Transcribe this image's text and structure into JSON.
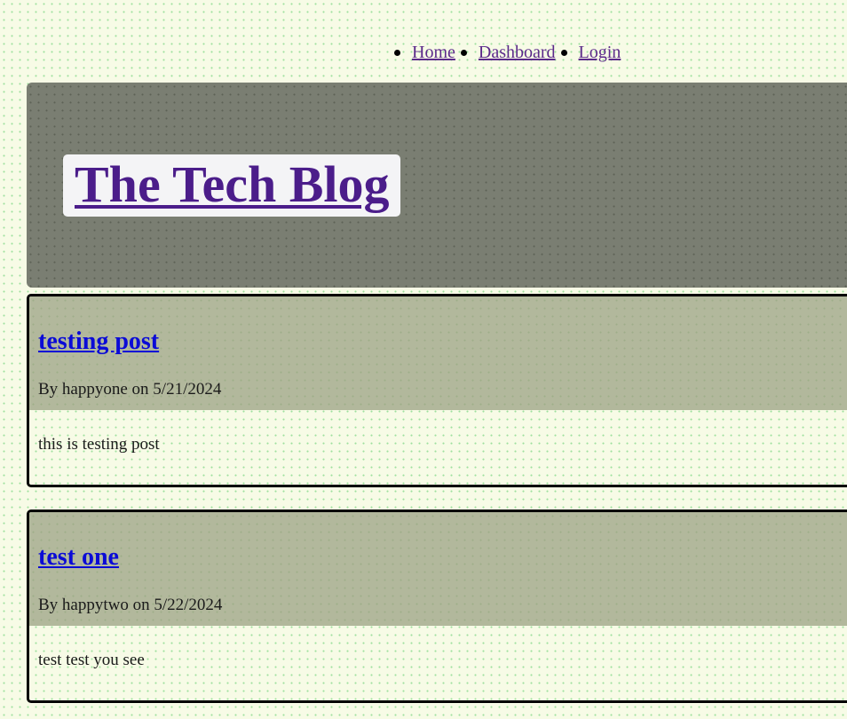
{
  "nav": {
    "items": [
      {
        "label": "Home"
      },
      {
        "label": "Dashboard"
      },
      {
        "label": "Login"
      }
    ]
  },
  "hero": {
    "title": "The Tech Blog"
  },
  "posts": [
    {
      "title": "testing post",
      "meta": "By happyone on 5/21/2024",
      "body": "this is testing post"
    },
    {
      "title": "test one",
      "meta": "By happytwo on 5/22/2024",
      "body": "test test you see"
    }
  ],
  "colors": {
    "page_bg": "#f7fbe6",
    "hero_bg": "#7a7e72",
    "post_header_bg": "#b2b89c",
    "title_link": "#4b1d8a",
    "post_link": "#0b0bd6",
    "nav_link": "#5b2a8a"
  }
}
